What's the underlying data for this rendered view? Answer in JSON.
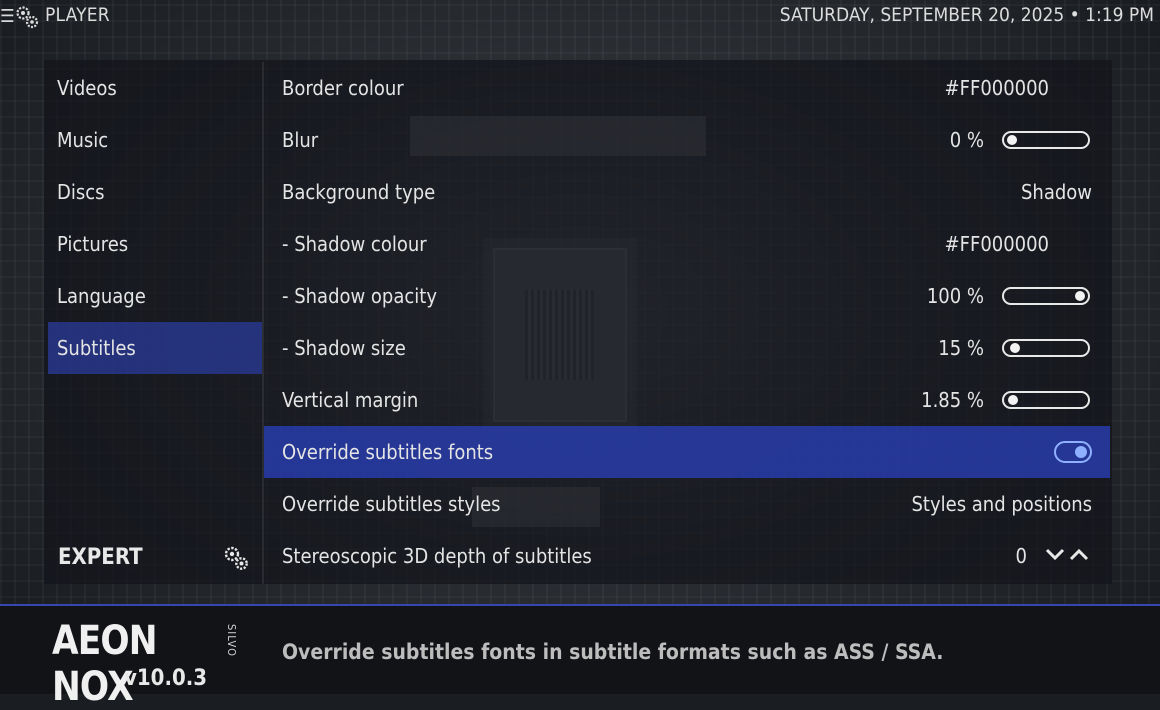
{
  "header": {
    "title": "PLAYER",
    "datetime": "SATURDAY, SEPTEMBER 20, 2025 • 1:19 PM",
    "menu_icon": "hamburger-menu-icon",
    "section_icon": "gears-icon"
  },
  "sidebar": {
    "items": [
      {
        "label": "Videos"
      },
      {
        "label": "Music"
      },
      {
        "label": "Discs"
      },
      {
        "label": "Pictures"
      },
      {
        "label": "Language"
      },
      {
        "label": "Subtitles",
        "active": true
      }
    ],
    "level": {
      "label": "EXPERT",
      "icon": "gears-icon"
    }
  },
  "settings": [
    {
      "label": "Border colour",
      "value": "#FF000000"
    },
    {
      "label": "Blur",
      "value": "0 %",
      "slider_level_percent": 0
    },
    {
      "label": "Background type",
      "value": "Shadow"
    },
    {
      "label": "- Shadow colour",
      "value": "#FF000000"
    },
    {
      "label": "- Shadow opacity",
      "value": "100 %",
      "slider_level_percent": 100
    },
    {
      "label": "- Shadow size",
      "value": "15 %",
      "slider_level_percent": 15
    },
    {
      "label": "Vertical margin",
      "value": "1.85 %",
      "slider_level_percent": 1.85
    },
    {
      "label": "Override subtitles fonts",
      "toggle": "on",
      "focused": true
    },
    {
      "label": "Override subtitles styles",
      "value": "Styles and positions"
    },
    {
      "label": "Stereoscopic 3D depth of subtitles",
      "value": "0",
      "spinner_icons": [
        "chevron-down-icon",
        "chevron-up-icon"
      ]
    }
  ],
  "footer": {
    "logo_text": "AEON NOX",
    "logo_sub": "SILVO",
    "version": "v10.0.3",
    "description": "Override subtitles fonts in subtitle formats such as ASS / SSA."
  },
  "colors": {
    "accent": "#2b3aa8",
    "focus_row": "#2a3caa",
    "footer_border": "#3a46b0",
    "toggle_on": "#8fb0ff"
  }
}
